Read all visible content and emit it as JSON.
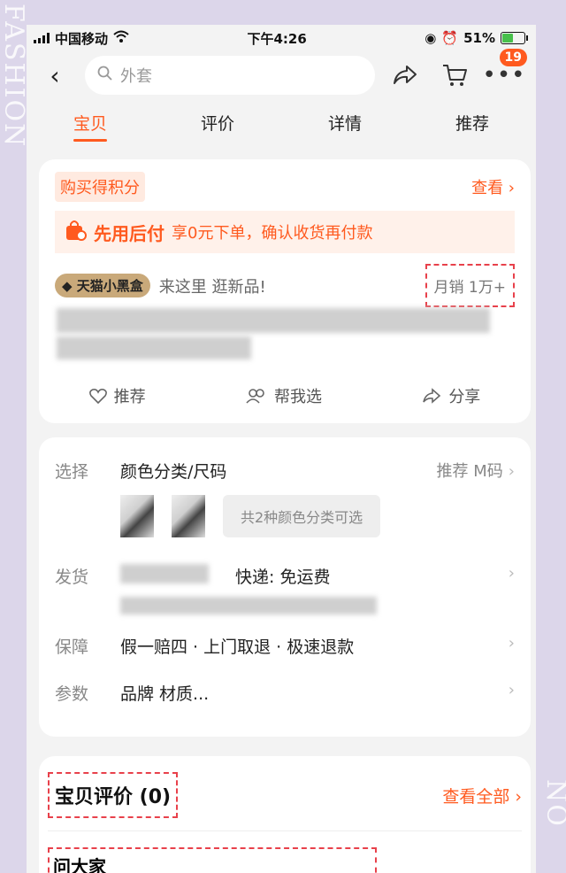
{
  "decor": {
    "left_text": "FASHION",
    "right_text": "NO"
  },
  "status_bar": {
    "carrier": "中国移动",
    "time": "下午4:26",
    "battery": "51%"
  },
  "top_bar": {
    "search_placeholder": "外套",
    "badge_count": "19"
  },
  "tabs": [
    {
      "label": "宝贝",
      "active": true
    },
    {
      "label": "评价"
    },
    {
      "label": "详情"
    },
    {
      "label": "推荐"
    }
  ],
  "promo": {
    "points_tag": "购买得积分",
    "view_link": "查看 ›",
    "paylater_title": "先用后付",
    "paylater_text": "享0元下单，确认收货再付款",
    "tmall_tag": "天猫小黑盒",
    "tmall_text": "来这里 逛新品!",
    "monthly_sales": "月销 1万+"
  },
  "actions": {
    "recommend": "推荐",
    "help_choose": "帮我选",
    "share": "分享"
  },
  "specs": {
    "select_label": "选择",
    "select_value": "颜色分类/尺码",
    "select_hint": "推荐 M码",
    "choice_pill": "共2种颜色分类可选",
    "ship_label": "发货",
    "ship_value": "快递: 免运费",
    "guarantee_label": "保障",
    "guarantee_value": "假一赔四 · 上门取退 · 极速退款",
    "param_label": "参数",
    "param_value": "品牌 材质..."
  },
  "reviews": {
    "title": "宝贝评价 (0)",
    "view_all": "查看全部 ›",
    "qa_title": "问大家"
  },
  "colors": {
    "accent": "#ff5a1f",
    "highlight_border": "#e8414b",
    "background": "#dcd6ea"
  }
}
